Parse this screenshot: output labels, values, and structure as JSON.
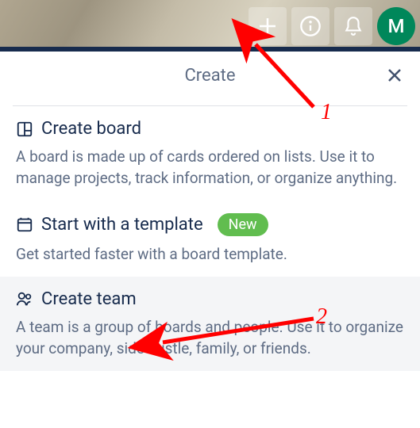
{
  "topbar": {
    "avatar_letter": "M"
  },
  "panel": {
    "title": "Create"
  },
  "options": {
    "board": {
      "title": "Create board",
      "desc": "A board is made up of cards ordered on lists. Use it to manage projects, track information, or organize anything."
    },
    "template": {
      "title": "Start with a template",
      "badge": "New",
      "desc": "Get started faster with a board template."
    },
    "team": {
      "title": "Create team",
      "desc": "A team is a group of boards and people. Use it to organize your company, side hustle, family, or friends."
    }
  },
  "annotations": {
    "label1": "1",
    "label2": "2"
  }
}
